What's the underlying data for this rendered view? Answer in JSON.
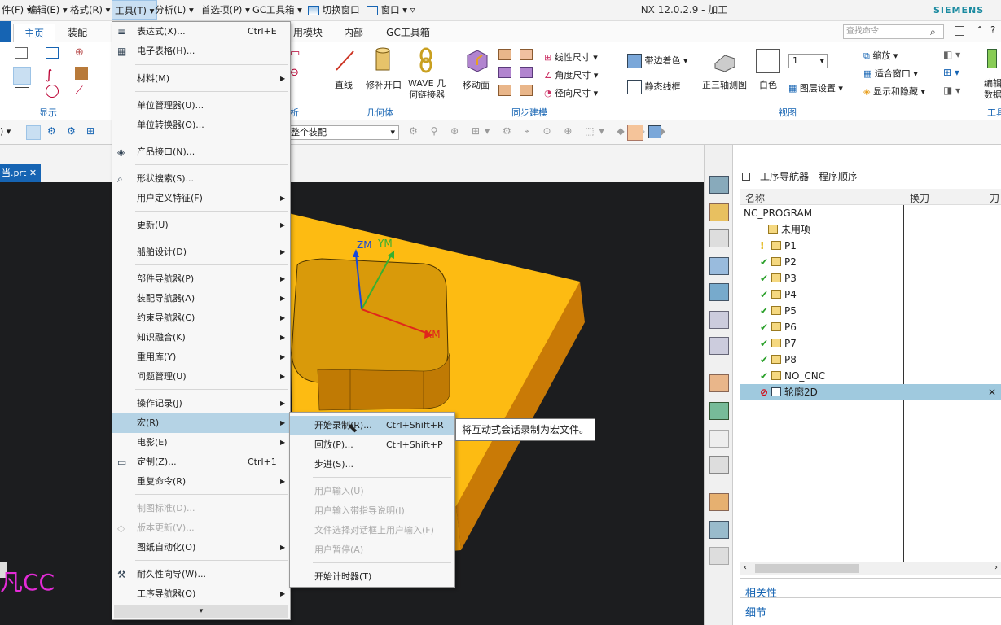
{
  "menubar": {
    "items": [
      "件(F)",
      "编辑(E)",
      "格式(R)",
      "工具(T)",
      "分析(L)",
      "首选项(P)",
      "GC工具箱"
    ],
    "switch_window": "切换窗口",
    "window": "窗口"
  },
  "window_title": "NX 12.0.2.9 - 加工",
  "brand": "SIEMENS",
  "ribbon_tabs": [
    "主页",
    "装配",
    "用模块",
    "内部",
    "GC工具箱"
  ],
  "search_placeholder": "查找命令",
  "ribbon": {
    "groups": {
      "display": "显示",
      "analysis": "析",
      "geometry": "几何体",
      "sync": "同步建模",
      "view": "视图",
      "tool": "工具"
    },
    "buttons": {
      "line": "直线",
      "trim": "修补开口",
      "wave": "WAVE 几\n何链接器",
      "move_face": "移动面",
      "linear_dim": "线性尺寸",
      "angle_dim": "角度尺寸",
      "radial_dim": "径向尺寸",
      "shaded_edges": "带边着色",
      "static_wireframe": "静态线框",
      "trimetric": "正三轴测图",
      "white": "白色",
      "layer_num": "1",
      "layer_settings": "图层设置",
      "zoom": "缩放",
      "fit_window": "适合窗口",
      "show_hide": "显示和隐藏",
      "edit_data": "编辑\n数据"
    }
  },
  "toolbar": {
    "assembly_filter": "整个装配"
  },
  "doc_tab": "当.prt",
  "viewport": {
    "axes": {
      "zm": "ZM",
      "ym": "YM",
      "xm": "XM"
    },
    "watermark": "凡CC"
  },
  "navigator": {
    "title": "工序导航器 - 程序顺序",
    "columns": [
      "名称",
      "换刀",
      "刀"
    ],
    "rows": [
      {
        "name": "NC_PROGRAM",
        "status": "none"
      },
      {
        "name": "未用项",
        "status": "none"
      },
      {
        "name": "P1",
        "status": "warn"
      },
      {
        "name": "P2",
        "status": "ok"
      },
      {
        "name": "P3",
        "status": "ok"
      },
      {
        "name": "P4",
        "status": "ok"
      },
      {
        "name": "P5",
        "status": "ok"
      },
      {
        "name": "P6",
        "status": "ok"
      },
      {
        "name": "P7",
        "status": "ok"
      },
      {
        "name": "P8",
        "status": "ok"
      },
      {
        "name": "NO_CNC",
        "status": "ok"
      },
      {
        "name": "轮廓2D",
        "status": "error"
      }
    ],
    "related": "相关性",
    "details": "细节"
  },
  "tools_menu": {
    "items": [
      {
        "label": "表达式(X)...",
        "shortcut": "Ctrl+E"
      },
      {
        "label": "电子表格(H)..."
      },
      {
        "label": "材料(M)"
      },
      {
        "label": "单位管理器(U)..."
      },
      {
        "label": "单位转换器(O)..."
      },
      {
        "label": "产品接口(N)..."
      },
      {
        "label": "形状搜索(S)..."
      },
      {
        "label": "用户定义特征(F)"
      },
      {
        "label": "更新(U)"
      },
      {
        "label": "船舶设计(D)"
      },
      {
        "label": "部件导航器(P)"
      },
      {
        "label": "装配导航器(A)"
      },
      {
        "label": "约束导航器(C)"
      },
      {
        "label": "知识融合(K)"
      },
      {
        "label": "重用库(Y)"
      },
      {
        "label": "问题管理(U)"
      },
      {
        "label": "操作记录(J)"
      },
      {
        "label": "宏(R)"
      },
      {
        "label": "电影(E)"
      },
      {
        "label": "定制(Z)...",
        "shortcut": "Ctrl+1"
      },
      {
        "label": "重复命令(R)"
      },
      {
        "label": "制图标准(D)..."
      },
      {
        "label": "版本更新(V)..."
      },
      {
        "label": "图纸自动化(O)"
      },
      {
        "label": "耐久性向导(W)..."
      },
      {
        "label": "工序导航器(O)"
      }
    ]
  },
  "macro_menu": {
    "items": [
      {
        "label": "开始录制(R)...",
        "shortcut": "Ctrl+Shift+R"
      },
      {
        "label": "回放(P)...",
        "shortcut": "Ctrl+Shift+P"
      },
      {
        "label": "步进(S)..."
      },
      {
        "label": "用户输入(U)"
      },
      {
        "label": "用户输入带指导说明(I)"
      },
      {
        "label": "文件选择对话框上用户输入(F)"
      },
      {
        "label": "用户暂停(A)"
      },
      {
        "label": "开始计时器(T)"
      }
    ],
    "tooltip": "将互动式会话录制为宏文件。"
  },
  "colors": {
    "accent": "#1664b3",
    "part": "#f5b800",
    "viewport_bg": "#1c1d1f",
    "highlight": "#b5d3e5"
  }
}
